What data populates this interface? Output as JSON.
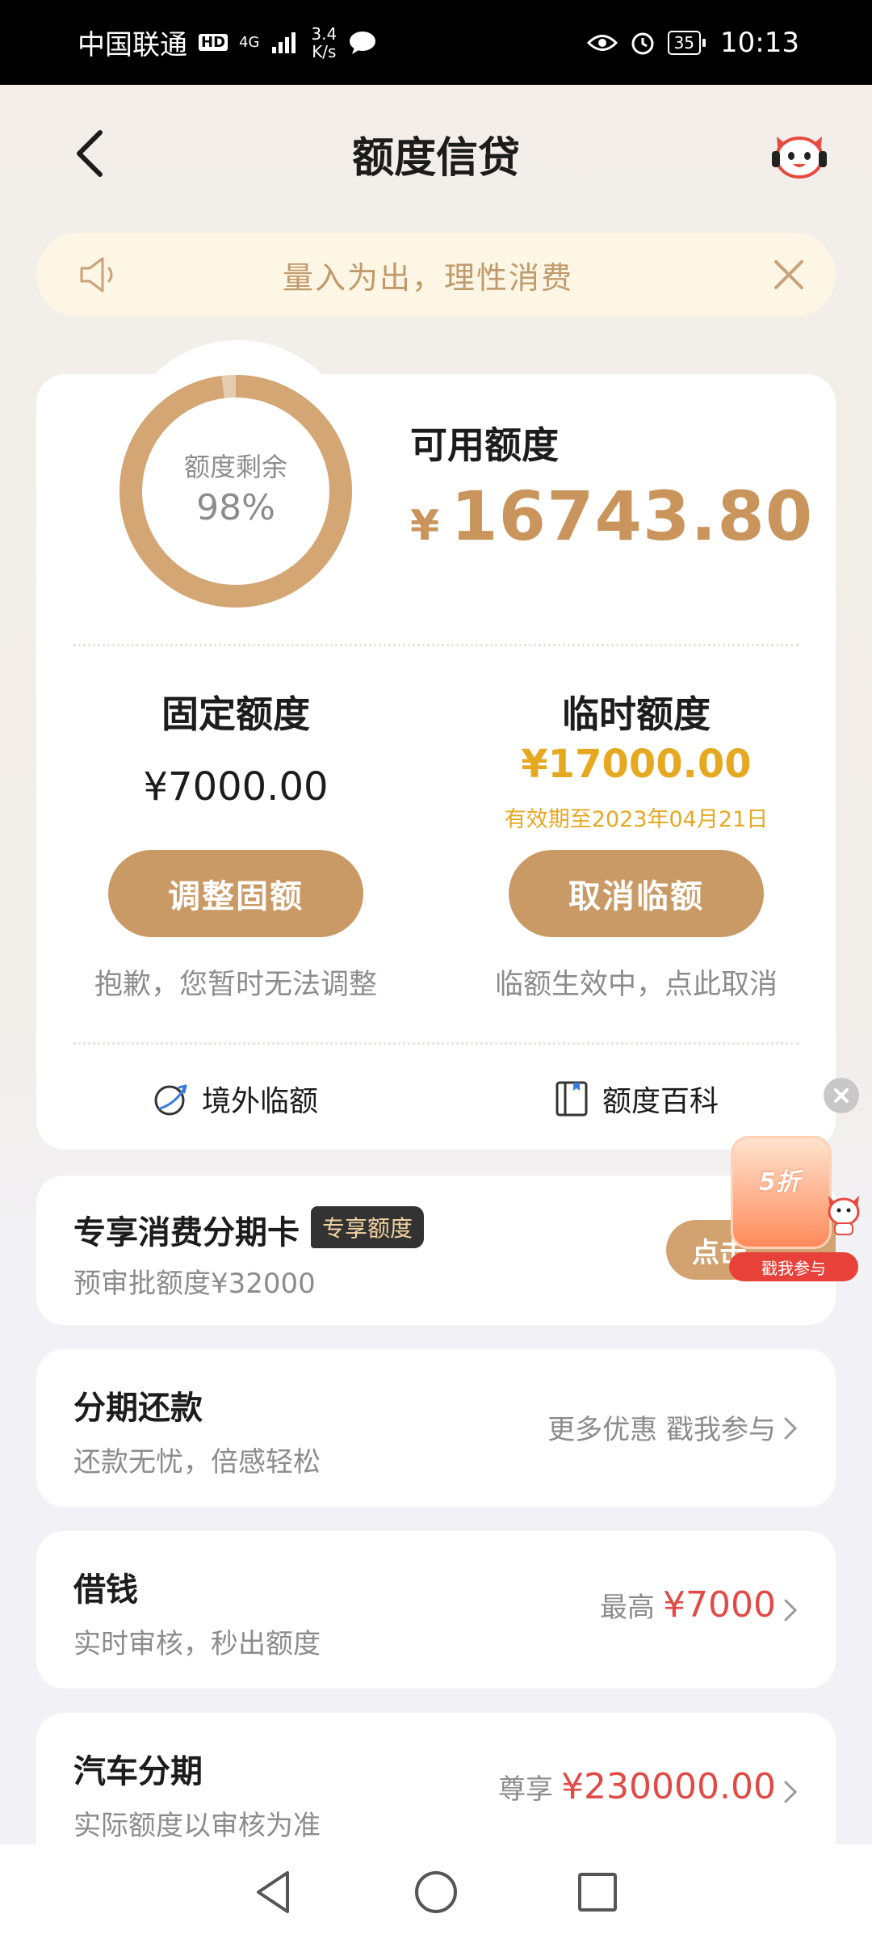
{
  "status_bar": {
    "carrier": "中国联通",
    "hd": "HD",
    "network": "4G",
    "speed_value": "3.4",
    "speed_unit": "K/s",
    "battery": "35",
    "time": "10:13"
  },
  "header": {
    "title": "额度信贷"
  },
  "notice": {
    "text": "量入为出，理性消费"
  },
  "quota": {
    "ring_label": "额度剩余",
    "remaining_percent_text": "98%",
    "remaining_fraction": 0.98,
    "available_label": "可用额度",
    "currency_symbol": "¥",
    "available_amount": "16743.80",
    "fixed": {
      "title": "固定额度",
      "amount": "¥7000.00",
      "button": "调整固额",
      "hint": "抱歉，您暂时无法调整"
    },
    "temporary": {
      "title": "临时额度",
      "amount": "¥17000.00",
      "expiry": "有效期至2023年04月21日",
      "button": "取消临额",
      "hint": "临额生效中，点此取消"
    },
    "links": [
      {
        "label": "境外临额",
        "icon": "globe-plane-icon"
      },
      {
        "label": "额度百科",
        "icon": "book-icon"
      }
    ]
  },
  "installment_card": {
    "title": "专享消费分期卡",
    "tag": "专享额度",
    "subtitle": "预审批额度¥32000",
    "cta": "点击"
  },
  "promo": {
    "discount": "5折",
    "button": "戳我参与"
  },
  "services": [
    {
      "title": "分期还款",
      "subtitle": "还款无忧，倍感轻松",
      "right_gray": "更多优惠 戳我参与",
      "right_red": ""
    },
    {
      "title": "借钱",
      "subtitle": "实时审核，秒出额度",
      "right_gray": "最高",
      "right_red": "¥7000"
    },
    {
      "title": "汽车分期",
      "subtitle": "实际额度以审核为准",
      "right_gray": "尊享",
      "right_red": "¥230000.00"
    }
  ],
  "colors": {
    "gold": "#c9955c",
    "button": "#c99a66",
    "expiry": "#e6a821",
    "red": "#e04a47"
  }
}
